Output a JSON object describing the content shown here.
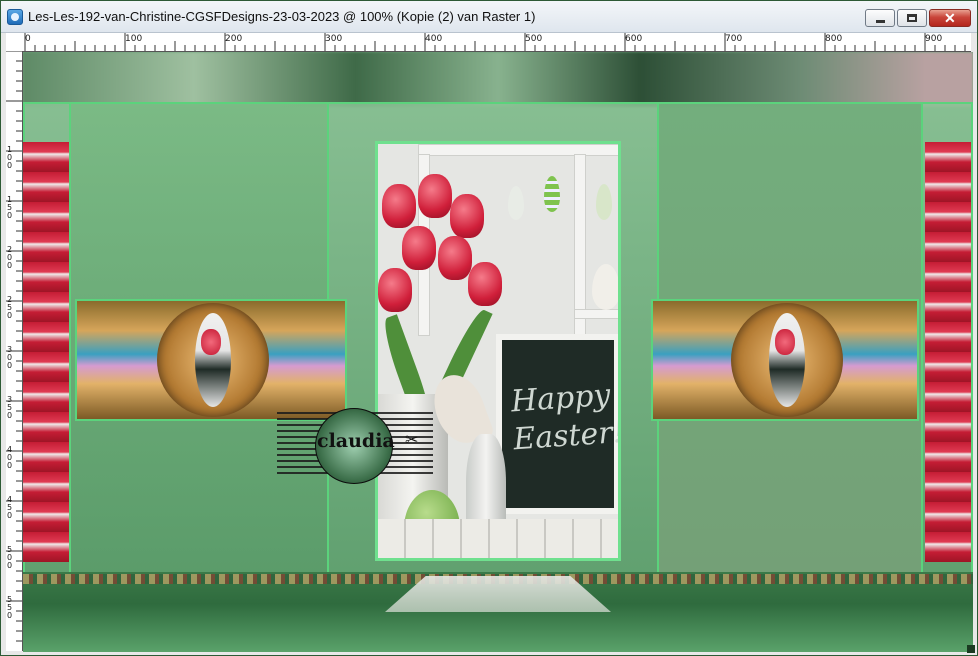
{
  "window": {
    "title": "Les-Les-192-van-Christine-CGSFDesigns-23-03-2023 @ 100% (Kopie (2) van Raster 1)",
    "app_icon": "paintshop-icon",
    "controls": {
      "minimize_icon": "minimize-icon",
      "maximize_icon": "maximize-icon",
      "close_icon": "close-icon"
    }
  },
  "ruler": {
    "horizontal_labels": [
      "0",
      "100",
      "200",
      "300",
      "400",
      "500",
      "600",
      "700",
      "800",
      "900"
    ],
    "vertical_labels": [
      "1",
      "0",
      "0",
      "1",
      "5",
      "0",
      "2",
      "0",
      "0",
      "2",
      "5",
      "0",
      "3",
      "0",
      "0",
      "3",
      "5",
      "0",
      "4",
      "0",
      "0",
      "4",
      "5",
      "0",
      "5",
      "0",
      "0",
      "5",
      "5",
      "0"
    ]
  },
  "canvas": {
    "chalkboard_text": "Happy Easter!",
    "watermark_text": "claudia",
    "watermark_icon": "scissors-icon",
    "accent_color": "#5bd37c",
    "tulip_color": "#d01f3a"
  }
}
